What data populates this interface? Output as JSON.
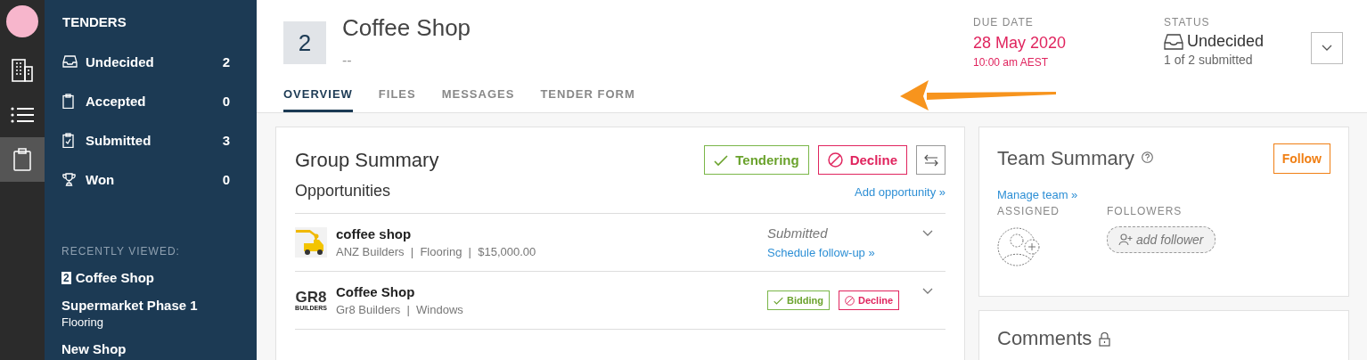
{
  "rail": {
    "items": [
      {
        "kind": "buildings",
        "selected": false
      },
      {
        "kind": "list",
        "selected": false
      },
      {
        "kind": "clipboard",
        "selected": true
      }
    ]
  },
  "sidebar": {
    "title": "TENDERS",
    "items": [
      {
        "kind": "inbox",
        "label": "Undecided",
        "count": "2"
      },
      {
        "kind": "clipboard",
        "label": "Accepted",
        "count": "0"
      },
      {
        "kind": "check",
        "label": "Submitted",
        "count": "3"
      },
      {
        "kind": "trophy",
        "label": "Won",
        "count": "0"
      }
    ],
    "recent_title": "RECENTLY VIEWED:",
    "recent": [
      {
        "badge": "2",
        "name": "Coffee Shop"
      },
      {
        "name": "Supermarket Phase 1",
        "sub": "Flooring"
      },
      {
        "name": "New Shop"
      }
    ]
  },
  "header": {
    "badge": "2",
    "title": "Coffee Shop",
    "subtitle": "--",
    "due_label": "DUE DATE",
    "due_date": "28 May 2020",
    "due_time": "10:00 am AEST",
    "status_label": "STATUS",
    "status": "Undecided",
    "status_sub": "1 of 2 submitted"
  },
  "tabs": [
    {
      "label": "OVERVIEW",
      "selected": true
    },
    {
      "label": "FILES",
      "selected": false
    },
    {
      "label": "MESSAGES",
      "selected": false
    },
    {
      "label": "TENDER FORM",
      "selected": false
    }
  ],
  "group": {
    "title": "Group Summary",
    "tendering": "Tendering",
    "decline": "Decline",
    "subtitle": "Opportunities",
    "add_link": "Add opportunity »",
    "rows": [
      {
        "kind": "truck",
        "name": "coffee shop",
        "meta": "ANZ Builders  |  Flooring  |  $15,000.00",
        "status": "Submitted",
        "link": "Schedule follow-up »"
      },
      {
        "kind": "gr8",
        "logo": [
          "GR8",
          "BUILDERS"
        ],
        "name": "Coffee Shop",
        "meta": "Gr8 Builders  |  Windows",
        "accept": "Bidding",
        "decline": "Decline"
      }
    ]
  },
  "team": {
    "title": "Team Summary",
    "follow": "Follow",
    "manage": "Manage team »",
    "assigned_label": "ASSIGNED",
    "followers_label": "FOLLOWERS",
    "add_follower": "add follower"
  },
  "comments": {
    "title": "Comments"
  }
}
